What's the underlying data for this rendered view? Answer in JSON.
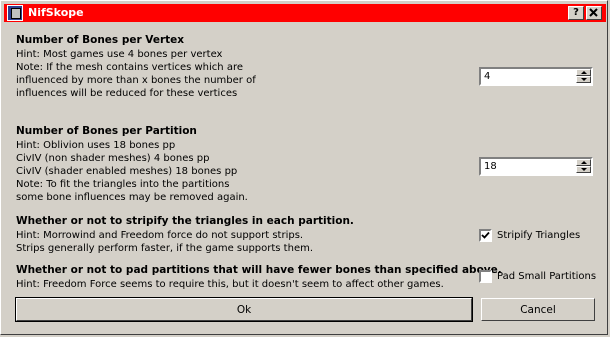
{
  "window": {
    "title": "NifSkope",
    "help_label": "?",
    "close_label": "X"
  },
  "vertex": {
    "heading": "Number of Bones per Vertex",
    "lines": [
      "Hint: Most games use 4 bones per vertex",
      "Note: If the mesh contains vertices which are",
      "influenced by more than x bones the number of",
      "influences will be reduced for these vertices"
    ],
    "value": "4"
  },
  "partition": {
    "heading": "Number of Bones per Partition",
    "lines": [
      "Hint: Oblivion uses 18 bones pp",
      "CivIV (non shader meshes) 4 bones pp",
      "CivIV (shader enabled meshes) 18 bones pp",
      "Note: To fit the triangles into the partitions",
      "some bone influences may be removed again."
    ],
    "value": "18"
  },
  "stripify": {
    "heading": "Whether or not to stripify the triangles in each partition.",
    "lines": [
      "Hint: Morrowind and Freedom force do not support strips.",
      "Strips generally perform faster, if the game supports them."
    ],
    "checkbox_label": "Stripify Triangles",
    "checked": true
  },
  "pad": {
    "heading": "Whether or not to pad partitions that will have fewer bones than specified above.",
    "lines": [
      "Hint: Freedom Force seems to require this, but it doesn't seem to affect other games."
    ],
    "checkbox_label": "Pad Small Partitions",
    "checked": false
  },
  "buttons": {
    "ok": "Ok",
    "cancel": "Cancel"
  }
}
